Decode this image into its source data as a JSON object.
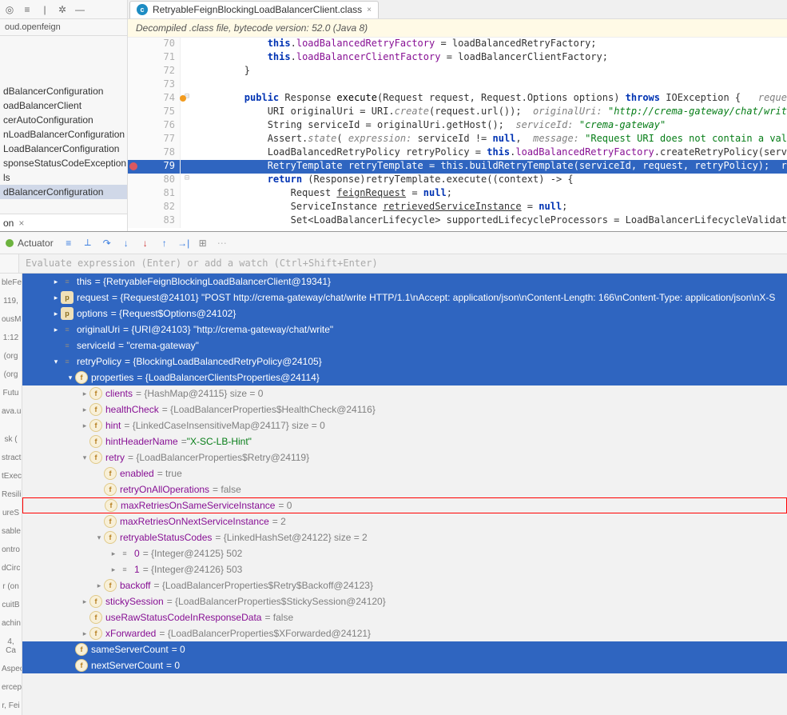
{
  "project": {
    "crumb": "oud.openfeign",
    "items": [
      "dBalancerConfiguration",
      "oadBalancerClient",
      "cerAutoConfiguration",
      "nLoadBalancerConfiguration",
      "LoadBalancerConfiguration",
      "sponseStatusCodeException",
      "ls",
      "dBalancerConfiguration"
    ],
    "selected_strip": "on"
  },
  "editor": {
    "tab_name": "RetryableFeignBlockingLoadBalancerClient.class",
    "banner": "Decompiled .class file, bytecode version: 52.0 (Java 8)",
    "lines": [
      {
        "n": 70,
        "html": "            <span class='kw'>this</span>.<span class='fld'>loadBalancedRetryFactory</span> = loadBalancedRetryFactory;"
      },
      {
        "n": 71,
        "html": "            <span class='kw'>this</span>.<span class='fld'>loadBalancerClientFactory</span> = loadBalancerClientFactory;"
      },
      {
        "n": 72,
        "html": "        }"
      },
      {
        "n": 73,
        "html": ""
      },
      {
        "n": 74,
        "fold": "⊟",
        "mark": true,
        "html": "        <span class='kw'>public</span> Response <span class='cls'>execute</span>(Request request, Request.Options options) <span class='kw'>throws</span> IOException {   <span class='it'>request: </span><span class='it-str'>\"POST http://crema-gateway/</span>"
      },
      {
        "n": 75,
        "html": "            URI originalUri = URI.<span class='it'>create</span>(request.url());  <span class='it'>originalUri: </span><span class='it-str'>\"http://crema-gateway/chat/write\"</span>"
      },
      {
        "n": 76,
        "html": "            String serviceId = originalUri.getHost();  <span class='it'>serviceId: </span><span class='it-str'>\"crema-gateway\"</span>"
      },
      {
        "n": 77,
        "html": "            Assert.<span class='it'>state</span>( <span class='it'>expression:</span> serviceId != <span class='kw'>null</span>,  <span class='it'>message:</span> <span class='str'>\"Request URI does not contain a valid hostname: \"</span> + originalUri);  <span class='it'>o</span>"
      },
      {
        "n": 78,
        "html": "            LoadBalancedRetryPolicy retryPolicy = <span class='kw'>this</span>.<span class='fld'>loadBalancedRetryFactory</span>.createRetryPolicy(serviceId, <span class='kw'>this</span>.<span class='fld'>loadBalancerClient</span>"
      },
      {
        "n": 79,
        "bp": true,
        "sel": true,
        "html": "            RetryTemplate retryTemplate = this.buildRetryTemplate(serviceId, request, retryPolicy);  request: \"POST http://-rema-gat"
      },
      {
        "n": 80,
        "fold": "⊟",
        "html": "            <span class='kw'>return</span> (Response)retryTemplate.execute((context) -> {"
      },
      {
        "n": 81,
        "html": "                Request <u>feignRequest</u> = <span class='kw'>null</span>;"
      },
      {
        "n": 82,
        "html": "                ServiceInstance <u>retrievedServiceInstance</u> = <span class='kw'>null</span>;"
      },
      {
        "n": 83,
        "html": "                Set&lt;LoadBalancerLifecycle&gt; supportedLifecycleProcessors = LoadBalancerLifecycleValidator.<span class='it'>getSupportedLifecycleProces</span>"
      }
    ]
  },
  "debug": {
    "actuator": "Actuator",
    "expr_placeholder": "Evaluate expression (Enter) or add a watch (Ctrl+Shift+Enter)",
    "frames": [
      "bleFe",
      "119,",
      "ousM",
      "1:12",
      "(org",
      "(org",
      "Futu",
      "ava.u",
      "",
      "sk (",
      "stract",
      "tExec",
      "Resili",
      "ureS",
      "sable",
      "ontro",
      "dCirc",
      "r (on",
      "cuitB",
      "achin",
      "4, Ca",
      "Aspec",
      "ercep",
      "r, Fei"
    ],
    "vars": [
      {
        "d": 0,
        "sel": true,
        "ico": "eq",
        "chev": ">",
        "key": "this",
        "val": " = {RetryableFeignBlockingLoadBalancerClient@19341}"
      },
      {
        "d": 0,
        "sel": true,
        "ico": "p",
        "chev": ">",
        "key": "request",
        "val": " = {Request@24101} \"POST http://crema-gateway/chat/write HTTP/1.1\\nAccept: application/json\\nContent-Length: 166\\nContent-Type: application/json\\nX-S"
      },
      {
        "d": 0,
        "sel": true,
        "ico": "p",
        "chev": ">",
        "key": "options",
        "val": " = {Request$Options@24102}"
      },
      {
        "d": 0,
        "sel": true,
        "ico": "eq",
        "chev": ">",
        "key": "originalUri",
        "val": " = {URI@24103} \"http://crema-gateway/chat/write\""
      },
      {
        "d": 0,
        "sel": true,
        "ico": "eq",
        "chev": "",
        "key": "serviceId",
        "val": " = \"crema-gateway\""
      },
      {
        "d": 0,
        "sel": true,
        "ico": "eq",
        "chev": "v",
        "key": "retryPolicy",
        "val": " = {BlockingLoadBalancedRetryPolicy@24105}"
      },
      {
        "d": 1,
        "sel": true,
        "ico": "f",
        "chev": "v",
        "key": "properties",
        "val": " = {LoadBalancerClientsProperties@24114}"
      },
      {
        "d": 2,
        "sel": false,
        "ico": "f",
        "chev": ">",
        "key": "clients",
        "val": " = {HashMap@24115}  size = 0"
      },
      {
        "d": 2,
        "sel": false,
        "ico": "f",
        "chev": ">",
        "key": "healthCheck",
        "val": " = {LoadBalancerProperties$HealthCheck@24116}"
      },
      {
        "d": 2,
        "sel": false,
        "ico": "f",
        "chev": ">",
        "key": "hint",
        "val": " = {LinkedCaseInsensitiveMap@24117}  size = 0"
      },
      {
        "d": 2,
        "sel": false,
        "ico": "f",
        "chev": "",
        "key": "hintHeaderName",
        "val": " = ",
        "str": "\"X-SC-LB-Hint\""
      },
      {
        "d": 2,
        "sel": false,
        "ico": "f",
        "chev": "v",
        "key": "retry",
        "val": " = {LoadBalancerProperties$Retry@24119}"
      },
      {
        "d": 3,
        "sel": false,
        "ico": "f",
        "chev": "",
        "key": "enabled",
        "val": " = true"
      },
      {
        "d": 3,
        "sel": false,
        "ico": "f",
        "chev": "",
        "key": "retryOnAllOperations",
        "val": " = false"
      },
      {
        "d": 3,
        "sel": false,
        "ico": "f",
        "chev": "",
        "boxed": true,
        "key": "maxRetriesOnSameServiceInstance",
        "val": " = 0"
      },
      {
        "d": 3,
        "sel": false,
        "ico": "f",
        "chev": "",
        "key": "maxRetriesOnNextServiceInstance",
        "val": " = 2"
      },
      {
        "d": 3,
        "sel": false,
        "ico": "f",
        "chev": "v",
        "key": "retryableStatusCodes",
        "val": " = {LinkedHashSet@24122}  size = 2"
      },
      {
        "d": 4,
        "sel": false,
        "ico": "eq",
        "chev": ">",
        "key": "0",
        "val": " = {Integer@24125} 502"
      },
      {
        "d": 4,
        "sel": false,
        "ico": "eq",
        "chev": ">",
        "key": "1",
        "val": " = {Integer@24126} 503"
      },
      {
        "d": 3,
        "sel": false,
        "ico": "f",
        "chev": ">",
        "key": "backoff",
        "val": " = {LoadBalancerProperties$Retry$Backoff@24123}"
      },
      {
        "d": 2,
        "sel": false,
        "ico": "f",
        "chev": ">",
        "key": "stickySession",
        "val": " = {LoadBalancerProperties$StickySession@24120}"
      },
      {
        "d": 2,
        "sel": false,
        "ico": "f",
        "chev": "",
        "key": "useRawStatusCodeInResponseData",
        "val": " = false"
      },
      {
        "d": 2,
        "sel": false,
        "ico": "f",
        "chev": ">",
        "key": "xForwarded",
        "val": " = {LoadBalancerProperties$XForwarded@24121}"
      },
      {
        "d": 1,
        "sel": true,
        "ico": "f",
        "chev": "",
        "key": "sameServerCount",
        "val": " = 0"
      },
      {
        "d": 1,
        "sel": true,
        "ico": "f",
        "chev": "",
        "key": "nextServerCount",
        "val": " = 0"
      }
    ]
  }
}
